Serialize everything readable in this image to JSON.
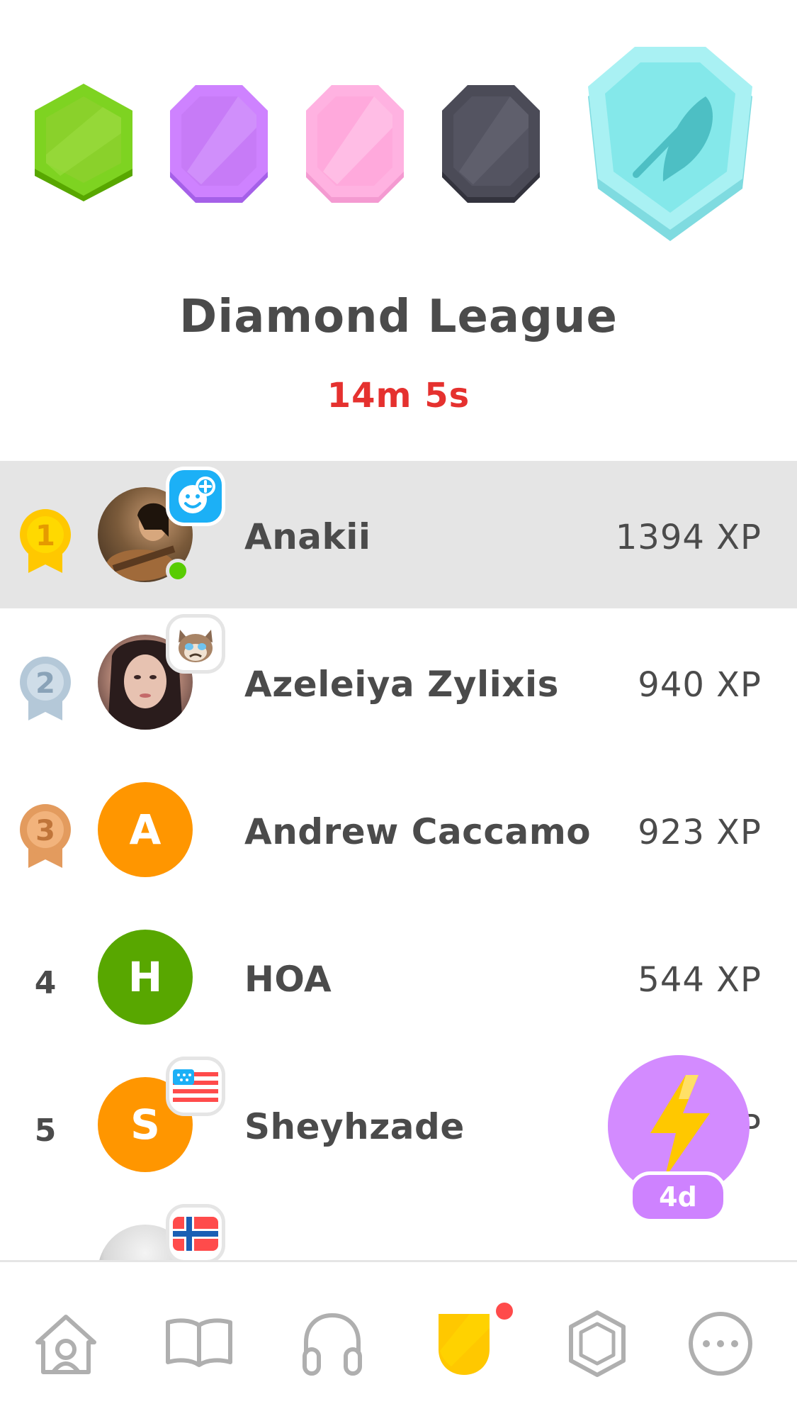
{
  "league": {
    "title": "Diamond League",
    "time_left": "14m 5s",
    "badges": [
      {
        "name": "emerald",
        "color": "#7ed321"
      },
      {
        "name": "amethyst",
        "color": "#ce82ff"
      },
      {
        "name": "pearl",
        "color": "#ffb2e1"
      },
      {
        "name": "obsidian",
        "color": "#4b4b57"
      },
      {
        "name": "diamond",
        "color": "#84e8ea",
        "current": true
      }
    ]
  },
  "leaderboard": [
    {
      "rank": "1",
      "medal": "gold",
      "name": "Anakii",
      "xp": "1394 XP",
      "avatar_color": "#7a5a3a",
      "highlight": true
    },
    {
      "rank": "2",
      "medal": "silver",
      "name": "Azeleiya Zylixis",
      "xp": "940 XP",
      "avatar_color": "#c9a39a"
    },
    {
      "rank": "3",
      "medal": "bronze",
      "name": "Andrew Caccamo",
      "xp": "923 XP",
      "avatar_letter": "A",
      "avatar_color": "#ff9600"
    },
    {
      "rank": "4",
      "name": "HOA",
      "xp": "544 XP",
      "avatar_letter": "H",
      "avatar_color": "#58a700"
    },
    {
      "rank": "5",
      "name": "Sheyhzade",
      "xp": "P",
      "avatar_letter": "S",
      "avatar_color": "#ff9600"
    }
  ],
  "powerup": {
    "label": "4d",
    "icon": "lightning-icon",
    "color": "#ce82ff"
  },
  "nav": {
    "items": [
      "home-icon",
      "book-icon",
      "headphones-icon",
      "league-shield-icon",
      "shop-gem-icon",
      "more-icon"
    ],
    "active": "league-shield-icon"
  },
  "colors": {
    "accent_red": "#e5312f",
    "online": "#58cc02",
    "text": "#4b4b4b"
  }
}
